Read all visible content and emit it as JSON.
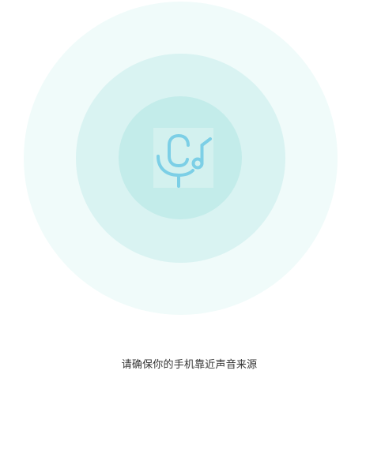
{
  "screen": {
    "hint_text": "请确保你的手机靠近声音来源",
    "icon": "microphone-music-note-icon",
    "colors": {
      "background": "#ffffff",
      "ring_outer": "#f0fbfa",
      "ring_middle": "#d9f3f2",
      "ring_inner": "#c3ecea",
      "icon_stroke": "#7ccfe6",
      "text": "#333333"
    }
  }
}
